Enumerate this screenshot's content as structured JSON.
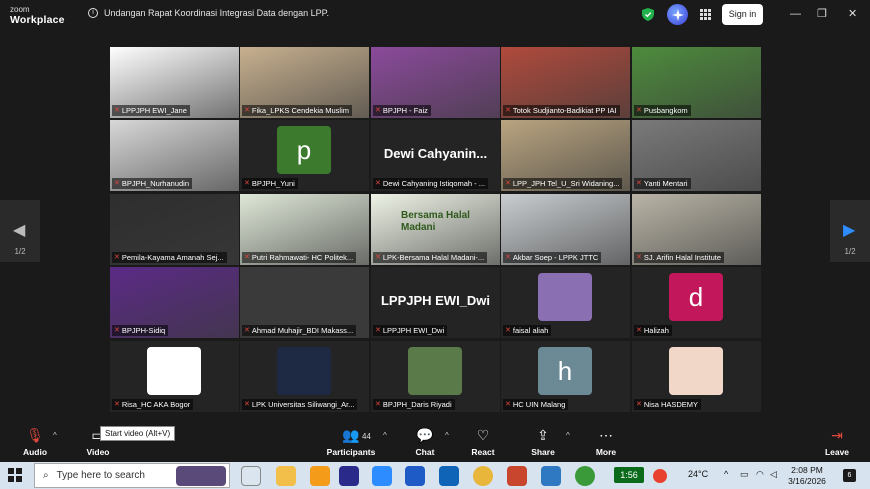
{
  "window": {
    "logo_line1": "zoom",
    "logo_line2": "Workplace",
    "meeting_title": "Undangan Rapat Koordinasi Integrasi Data dengan LPP.",
    "signin_label": "Sign in",
    "minimize": "—",
    "restore": "❐",
    "close": "✕"
  },
  "pager": {
    "prev_page": "1/2",
    "next_page": "1/2"
  },
  "participants": [
    {
      "name": "LPPJPH EWI_Jane",
      "kind": "logo",
      "bg": "#ffffff"
    },
    {
      "name": "Fika_LPKS Cendekia Muslim",
      "kind": "photo",
      "bg": "#c7b08f"
    },
    {
      "name": "BPJPH - Faiz",
      "kind": "photo",
      "bg": "#8b4a9b"
    },
    {
      "name": "Totok Sudjianto-Badikiat PP IAI",
      "kind": "photo",
      "bg": "#b04a3c"
    },
    {
      "name": "Pusbangkom",
      "kind": "photo",
      "bg": "#4d8b3c"
    },
    {
      "name": "BPJPH_Nurhanudin",
      "kind": "photo",
      "bg": "#d8d8d8",
      "active": true
    },
    {
      "name": "BPJPH_Yuni",
      "kind": "avatar",
      "letter": "p",
      "bg": "#3c7a2e"
    },
    {
      "name": "Dewi Cahyaning Istiqomah - ...",
      "kind": "text",
      "big": "Dewi Cahyanin..."
    },
    {
      "name": "LPP_JPH Tel_U_Sri Widaning...",
      "kind": "photo",
      "bg": "#b9a480"
    },
    {
      "name": "Yanti Mentari",
      "kind": "photo",
      "bg": "#7a7a7a"
    },
    {
      "name": "Pemila-Kayama Amanah Sej...",
      "kind": "photo",
      "bg": "#2e2e2e"
    },
    {
      "name": "Putri Rahmawati- HC Politek...",
      "kind": "photo",
      "bg": "#dfe8d8"
    },
    {
      "name": "LPK-Bersama Halal Madani-...",
      "kind": "logo",
      "bg": "#eef3e6",
      "banner": "Bersama Halal Madani"
    },
    {
      "name": "Akbar Soep - LPPK JTTC",
      "kind": "photo",
      "bg": "#c9cdd0"
    },
    {
      "name": "SJ. Arifin Halal Institute",
      "kind": "photo",
      "bg": "#b9b4a6"
    },
    {
      "name": "BPJPH-Sidiq",
      "kind": "photo",
      "bg": "#5b2a86"
    },
    {
      "name": "Ahmad Muhajir_BDI Makass...",
      "kind": "photo",
      "bg": "#3a3a3a"
    },
    {
      "name": "LPPJPH EWI_Dwi",
      "kind": "text",
      "big": "LPPJPH EWI_Dwi"
    },
    {
      "name": "faisal aliah",
      "kind": "pic",
      "bg": "#8a6fb3"
    },
    {
      "name": "Halizah",
      "kind": "avatar",
      "letter": "d",
      "bg": "#c2185b"
    },
    {
      "name": "Risa_HC AKA Bogor",
      "kind": "pic",
      "bg": "#ffffff"
    },
    {
      "name": "LPK Universitas Siliwangi_Ar...",
      "kind": "pic",
      "bg": "#1e2a44"
    },
    {
      "name": "BPJPH_Daris Riyadi",
      "kind": "pic",
      "bg": "#5a7a4a"
    },
    {
      "name": "HC UIN Malang",
      "kind": "avatar",
      "letter": "h",
      "bg": "#6b8a95"
    },
    {
      "name": "Nisa HASDEMY",
      "kind": "pic",
      "bg": "#f1d7c8"
    }
  ],
  "toolbar": {
    "audio": "Audio",
    "video": "Video",
    "participants": "Participants",
    "participants_count": "44",
    "chat": "Chat",
    "react": "React",
    "share": "Share",
    "more": "More",
    "leave": "Leave",
    "tooltip": "Start video (Alt+V)"
  },
  "taskbar": {
    "search_placeholder": "Type here to search",
    "timer": "1:56",
    "weather": "24°C",
    "time": "2:08 PM",
    "date": "3/16/2026",
    "notifications": "6"
  }
}
